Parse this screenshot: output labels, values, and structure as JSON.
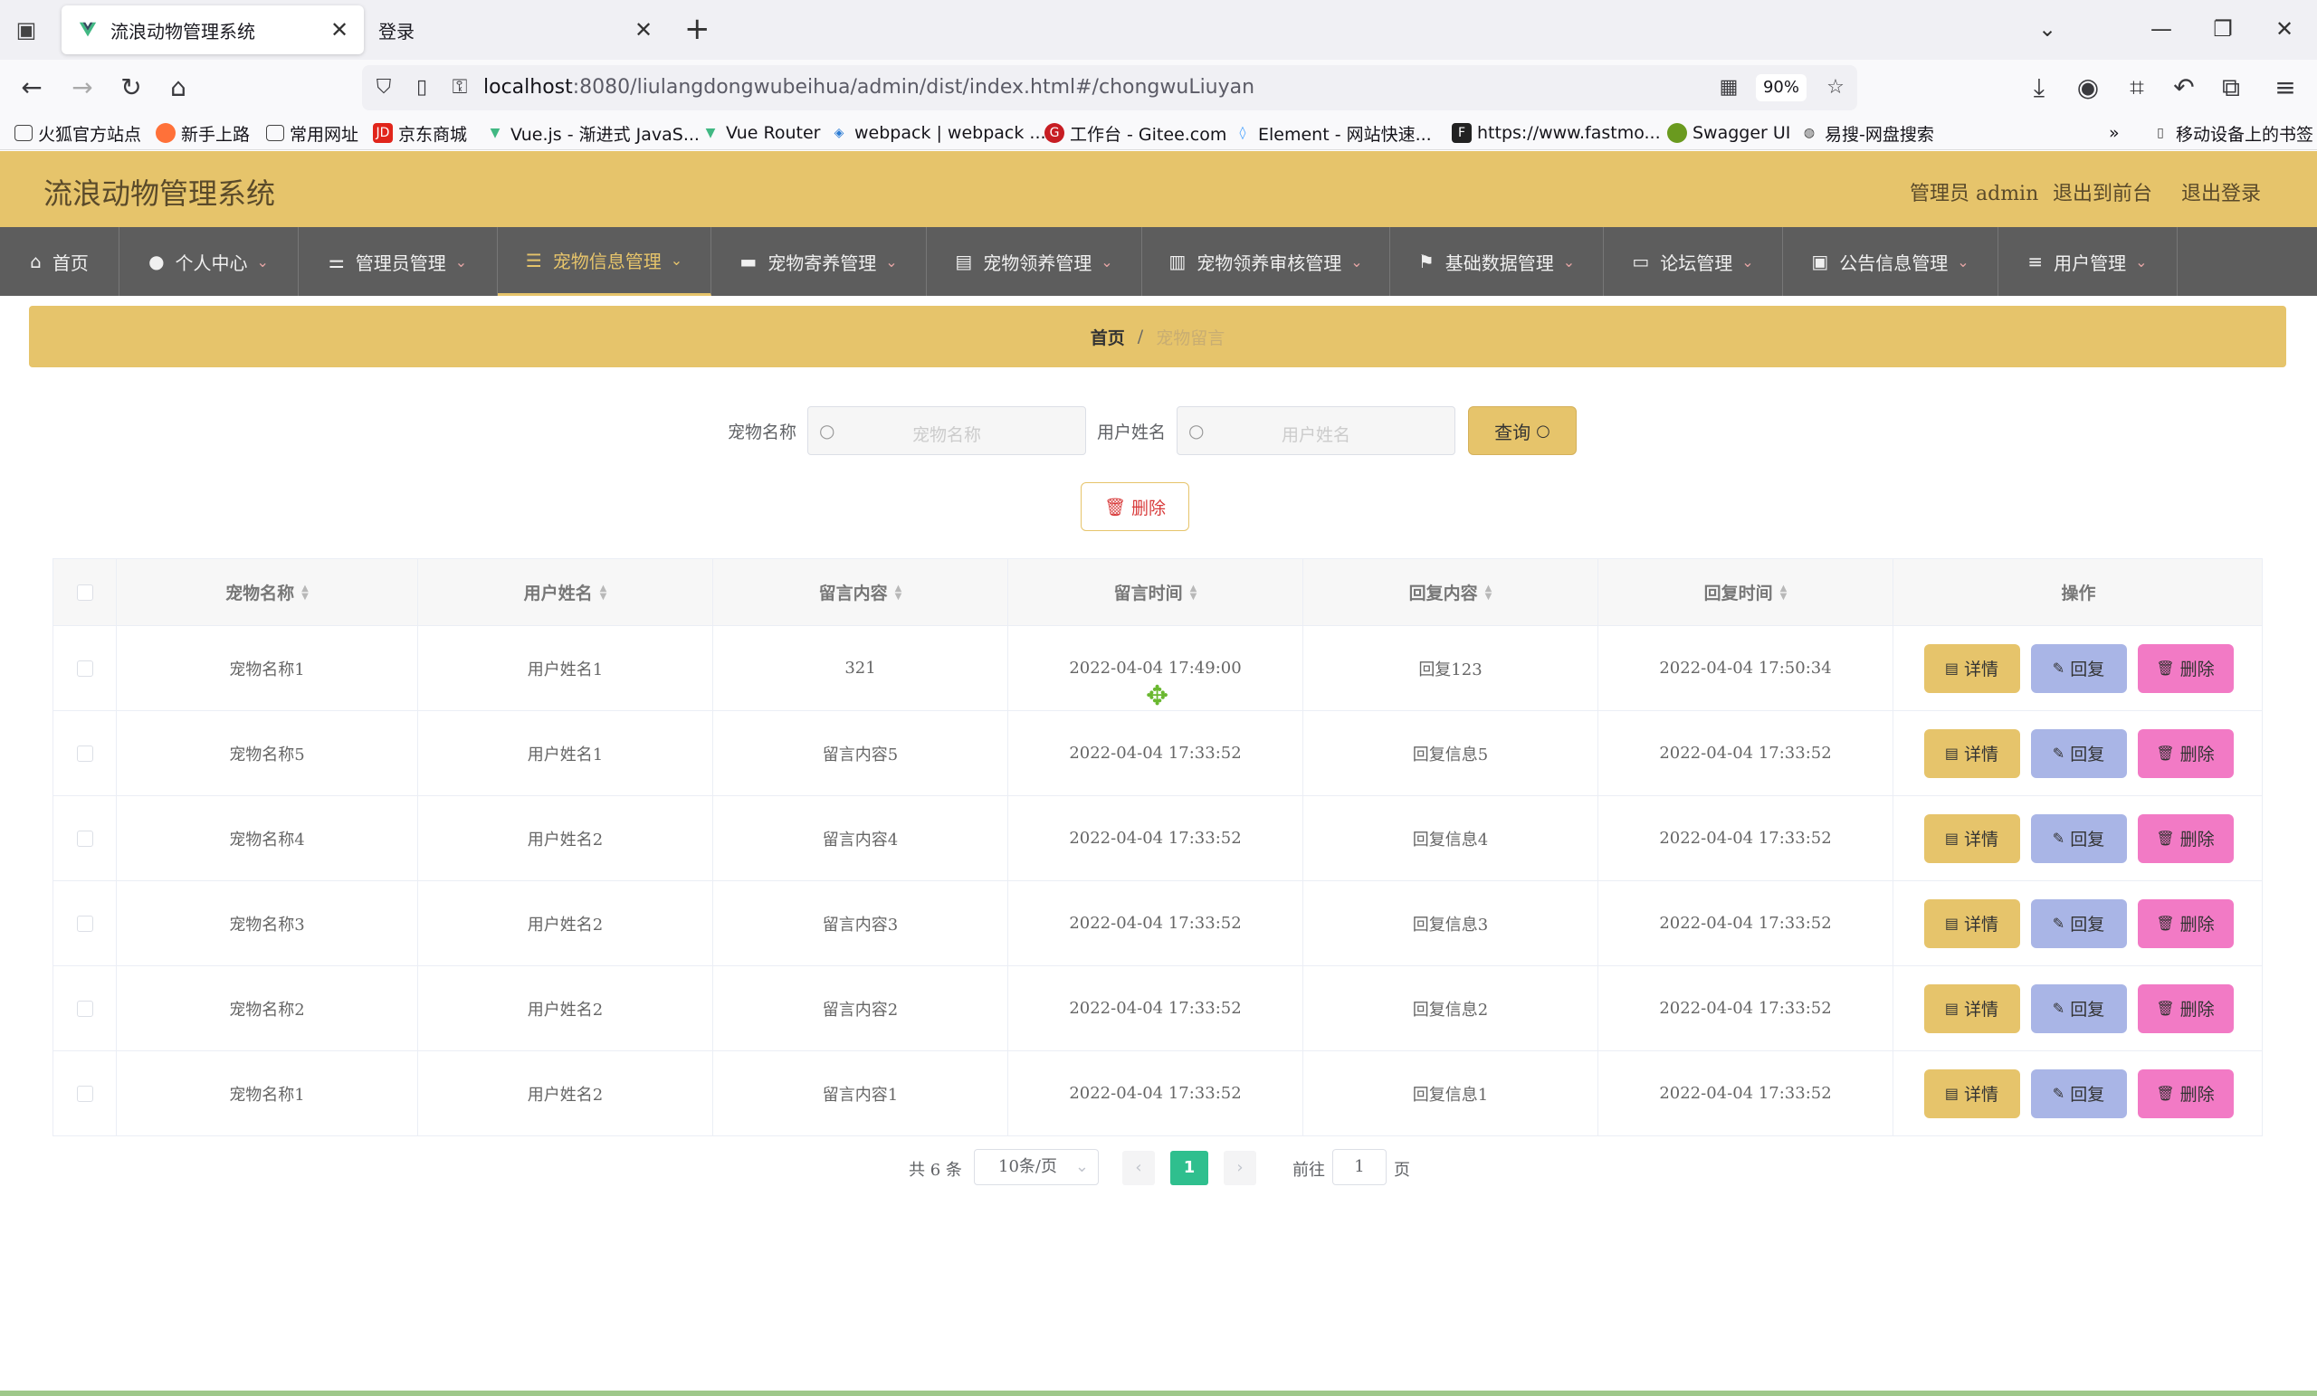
{
  "browser": {
    "tabs": [
      {
        "title": "流浪动物管理系统",
        "active": true
      },
      {
        "title": "登录",
        "active": false
      }
    ],
    "url_host": "localhost",
    "url_rest": ":8080/liulangdongwubeihua/admin/dist/index.html#/chongwuLiuyan",
    "zoom": "90%",
    "bookmarks": [
      "火狐官方站点",
      "新手上路",
      "常用网址",
      "京东商城",
      "Vue.js - 渐进式 JavaS...",
      "Vue Router",
      "webpack | webpack ...",
      "工作台 - Gitee.com",
      "Element - 网站快速...",
      "https://www.fastmo...",
      "Swagger UI",
      "易搜-网盘搜索"
    ],
    "mobile_bookmarks": "移动设备上的书签"
  },
  "header": {
    "title": "流浪动物管理系统",
    "admin_label": "管理员 admin",
    "to_front": "退出到前台",
    "logout": "退出登录"
  },
  "menu": [
    {
      "label": "首页",
      "icon": "home-icon"
    },
    {
      "label": "个人中心",
      "icon": "user-icon"
    },
    {
      "label": "管理员管理",
      "icon": "sliders-icon"
    },
    {
      "label": "宠物信息管理",
      "icon": "list-icon",
      "active": true
    },
    {
      "label": "宠物寄养管理",
      "icon": "ticket-icon"
    },
    {
      "label": "宠物领养管理",
      "icon": "clipboard-icon"
    },
    {
      "label": "宠物领养审核管理",
      "icon": "building-icon"
    },
    {
      "label": "基础数据管理",
      "icon": "flag-icon"
    },
    {
      "label": "论坛管理",
      "icon": "monitor-icon"
    },
    {
      "label": "公告信息管理",
      "icon": "briefcase-icon"
    },
    {
      "label": "用户管理",
      "icon": "menu-icon"
    }
  ],
  "breadcrumb": {
    "home": "首页",
    "sep": "/",
    "current": "宠物留言"
  },
  "search": {
    "pet_label": "宠物名称",
    "pet_placeholder": "宠物名称",
    "user_label": "用户姓名",
    "user_placeholder": "用户姓名",
    "query_button": "查询",
    "delete_button": "删除"
  },
  "table": {
    "columns": [
      "宠物名称",
      "用户姓名",
      "留言内容",
      "留言时间",
      "回复内容",
      "回复时间",
      "操作"
    ],
    "actions": {
      "detail": "详情",
      "reply": "回复",
      "delete": "删除"
    },
    "rows": [
      [
        "宠物名称1",
        "用户姓名1",
        "321",
        "2022-04-04 17:49:00",
        "回复123",
        "2022-04-04 17:50:34"
      ],
      [
        "宠物名称5",
        "用户姓名1",
        "留言内容5",
        "2022-04-04 17:33:52",
        "回复信息5",
        "2022-04-04 17:33:52"
      ],
      [
        "宠物名称4",
        "用户姓名2",
        "留言内容4",
        "2022-04-04 17:33:52",
        "回复信息4",
        "2022-04-04 17:33:52"
      ],
      [
        "宠物名称3",
        "用户姓名2",
        "留言内容3",
        "2022-04-04 17:33:52",
        "回复信息3",
        "2022-04-04 17:33:52"
      ],
      [
        "宠物名称2",
        "用户姓名2",
        "留言内容2",
        "2022-04-04 17:33:52",
        "回复信息2",
        "2022-04-04 17:33:52"
      ],
      [
        "宠物名称1",
        "用户姓名2",
        "留言内容1",
        "2022-04-04 17:33:52",
        "回复信息1",
        "2022-04-04 17:33:52"
      ]
    ]
  },
  "pagination": {
    "total": "共 6 条",
    "page_size": "10条/页",
    "current_page": "1",
    "goto_prefix": "前往",
    "goto_value": "1",
    "goto_suffix": "页"
  },
  "colors": {
    "accent": "#e6c46b",
    "menu_bg": "#5d5d5d",
    "pager_active": "#2fbf8e",
    "reply": "#a9b5e6",
    "delete": "#f27ac5"
  }
}
